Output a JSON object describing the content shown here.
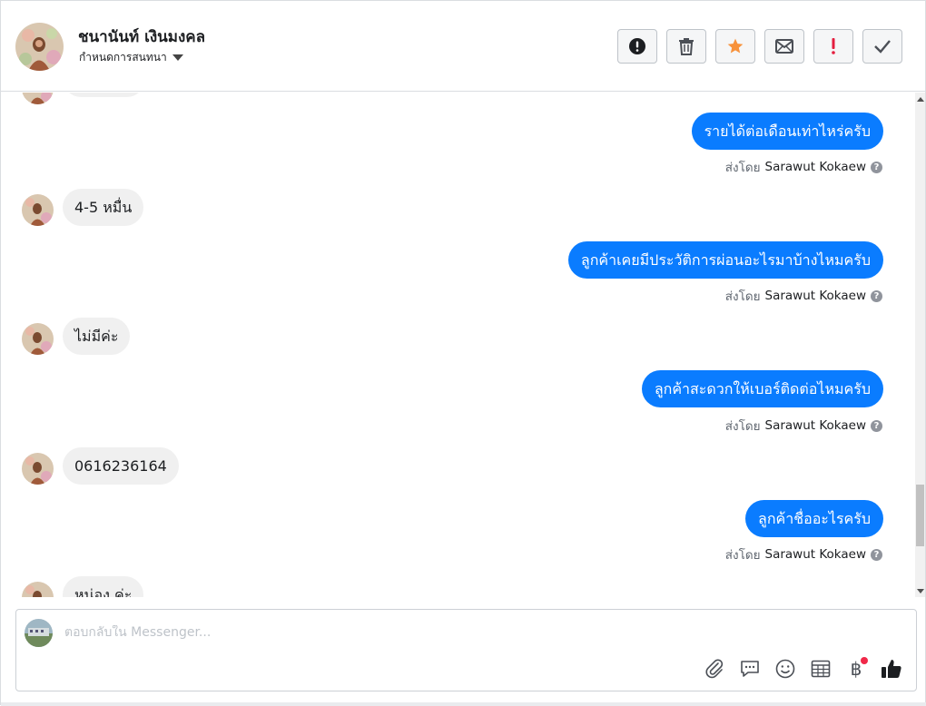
{
  "header": {
    "contact_name": "ชนานันท์ เงินมงคล",
    "assign_label": "กำหนดการสนทนา",
    "actions": [
      {
        "name": "mark-spam-button",
        "icon": "alert-circle-icon"
      },
      {
        "name": "delete-button",
        "icon": "trash-icon"
      },
      {
        "name": "star-button",
        "icon": "star-icon"
      },
      {
        "name": "mark-unread-button",
        "icon": "envelope-icon"
      },
      {
        "name": "follow-up-button",
        "icon": "exclamation-icon"
      },
      {
        "name": "mark-done-button",
        "icon": "checkmark-icon"
      }
    ]
  },
  "colors": {
    "outgoing_bubble": "#0a7cff",
    "incoming_bubble": "#f0f0f0",
    "star": "#f7923b",
    "follow_up": "#e41e3f"
  },
  "messages": [
    {
      "direction": "out",
      "text": "รายได้ต่อเดือนเท่าไหร่ครับ",
      "sent_by_label": "ส่งโดย",
      "sender": "Sarawut Kokaew"
    },
    {
      "direction": "in",
      "text": "4-5 หมื่น"
    },
    {
      "direction": "out",
      "text": "ลูกค้าเคยมีประวัติการผ่อนอะไรมาบ้างไหมครับ",
      "sent_by_label": "ส่งโดย",
      "sender": "Sarawut Kokaew"
    },
    {
      "direction": "in",
      "text": "ไม่มีค่ะ"
    },
    {
      "direction": "out",
      "text": "ลูกค้าสะดวกให้เบอร์ติดต่อไหมครับ",
      "sent_by_label": "ส่งโดย",
      "sender": "Sarawut Kokaew"
    },
    {
      "direction": "in",
      "text": "0616236164"
    },
    {
      "direction": "out",
      "text": "ลูกค้าชื่ออะไรครับ",
      "sent_by_label": "ส่งโดย",
      "sender": "Sarawut Kokaew"
    },
    {
      "direction": "in",
      "text": "หน่อง ค่ะ"
    }
  ],
  "composer": {
    "placeholder": "ตอบกลับใน Messenger...",
    "tools": [
      "paperclip-icon",
      "saved-reply-icon",
      "emoji-icon",
      "calendar-icon",
      "baht-icon",
      "like-icon"
    ],
    "baht_symbol": "฿"
  }
}
